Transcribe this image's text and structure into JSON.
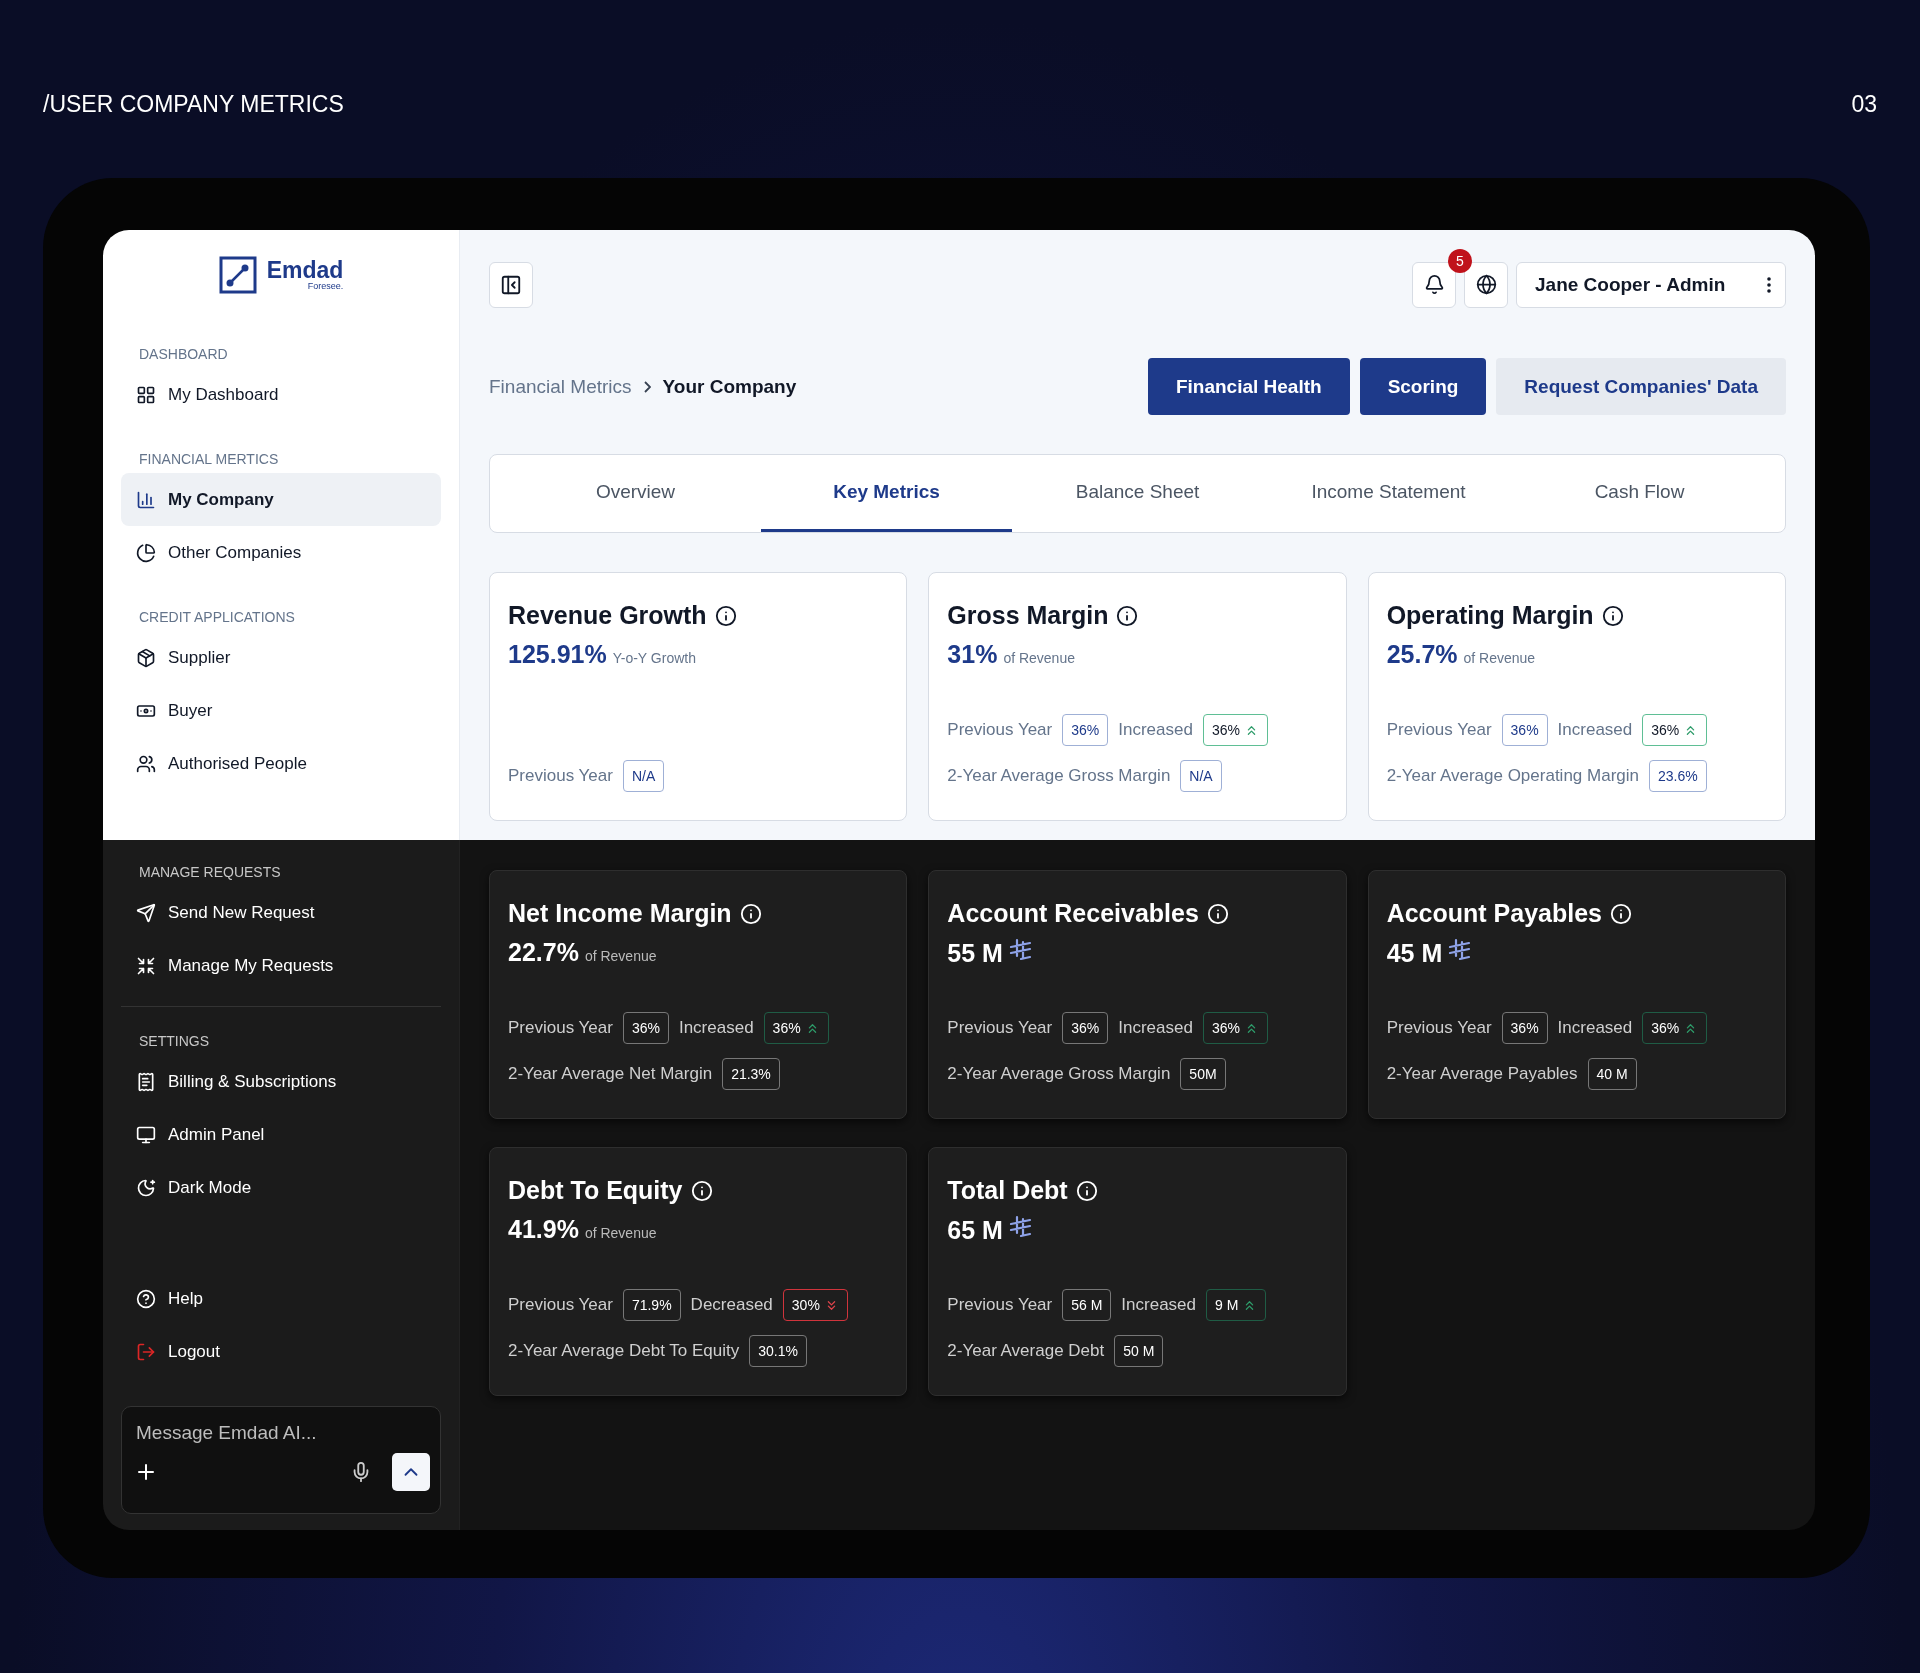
{
  "page_header": {
    "title": "/USER COMPANY METRICS",
    "number": "03"
  },
  "sidebar": {
    "logo": {
      "name": "Emdad",
      "tagline": "Foresee."
    },
    "sections": [
      {
        "heading": "DASHBOARD",
        "dark": false,
        "items": [
          {
            "label": "My Dashboard",
            "selected": false
          }
        ]
      },
      {
        "heading": "FINANCIAL MERTICS",
        "dark": false,
        "items": [
          {
            "label": "My Company",
            "selected": true
          },
          {
            "label": "Other Companies",
            "selected": false
          }
        ]
      },
      {
        "heading": "CREDIT APPLICATIONS",
        "dark": false,
        "items": [
          {
            "label": "Supplier",
            "selected": false
          },
          {
            "label": "Buyer",
            "selected": false
          },
          {
            "label": "Authorised People",
            "selected": false
          }
        ]
      },
      {
        "heading": "MANAGE REQUESTS",
        "dark": true,
        "divider": true,
        "items": [
          {
            "label": "Send New Request",
            "selected": false
          },
          {
            "label": "Manage My Requests",
            "selected": false
          }
        ]
      },
      {
        "heading": "SETTINGS",
        "dark": true,
        "items": [
          {
            "label": "Billing & Subscriptions",
            "selected": false
          },
          {
            "label": "Admin Panel",
            "selected": false
          },
          {
            "label": "Dark Mode",
            "selected": false
          }
        ]
      }
    ],
    "footer_items": [
      {
        "label": "Help",
        "kind": "normal"
      },
      {
        "label": "Logout",
        "kind": "danger"
      }
    ],
    "chat": {
      "placeholder": "Message Emdad AI..."
    }
  },
  "topbar": {
    "notifications": "5",
    "user": "Jane Cooper - Admin"
  },
  "breadcrumb": [
    {
      "label": "Financial Metrics",
      "selected": false
    },
    {
      "label": "Your Company",
      "selected": true
    }
  ],
  "actions": [
    {
      "label": "Financial Health",
      "kind": "primary"
    },
    {
      "label": "Scoring",
      "kind": "primary"
    },
    {
      "label": "Request Companies' Data",
      "kind": "secondary"
    }
  ],
  "tabs": [
    {
      "label": "Overview",
      "selected": false
    },
    {
      "label": "Key Metrics",
      "selected": true
    },
    {
      "label": "Balance Sheet",
      "selected": false
    },
    {
      "label": "Income Statement",
      "selected": false
    },
    {
      "label": "Cash Flow",
      "selected": false
    }
  ],
  "card_rows": [
    {
      "dark": false,
      "cards": [
        {
          "title": "Revenue Growth",
          "value": "125.91%",
          "note": "Y-o-Y Growth",
          "currency": false,
          "lines": [
            [
              {
                "label": "Previous Year",
                "value": "N/A",
                "kind": "plain"
              }
            ]
          ]
        },
        {
          "title": "Gross Margin",
          "value": "31%",
          "note": "of Revenue",
          "currency": false,
          "lines": [
            [
              {
                "label": "Previous Year",
                "value": "36%",
                "kind": "plain"
              },
              {
                "label": "Increased",
                "value": "36%",
                "kind": "up"
              }
            ],
            [
              {
                "label": "2-Year Average Gross Margin",
                "value": "N/A",
                "kind": "plain"
              }
            ]
          ]
        },
        {
          "title": "Operating Margin",
          "value": "25.7%",
          "note": "of Revenue",
          "currency": false,
          "lines": [
            [
              {
                "label": "Previous Year",
                "value": "36%",
                "kind": "plain"
              },
              {
                "label": "Increased",
                "value": "36%",
                "kind": "up"
              }
            ],
            [
              {
                "label": "2-Year Average Operating Margin",
                "value": "23.6%",
                "kind": "plain"
              }
            ]
          ]
        }
      ]
    },
    {
      "dark": true,
      "cards": [
        {
          "title": "Net Income Margin",
          "value": "22.7%",
          "note": "of Revenue",
          "currency": false,
          "lines": [
            [
              {
                "label": "Previous Year",
                "value": "36%",
                "kind": "plain"
              },
              {
                "label": "Increased",
                "value": "36%",
                "kind": "up"
              }
            ],
            [
              {
                "label": "2-Year Average Net Margin",
                "value": "21.3%",
                "kind": "plain"
              }
            ]
          ]
        },
        {
          "title": "Account Receivables",
          "value": "55 M",
          "currency": true,
          "lines": [
            [
              {
                "label": "Previous Year",
                "value": "36%",
                "kind": "plain"
              },
              {
                "label": "Increased",
                "value": "36%",
                "kind": "up"
              }
            ],
            [
              {
                "label": "2-Year Average Gross Margin",
                "value": "50M",
                "kind": "plain"
              }
            ]
          ]
        },
        {
          "title": "Account Payables",
          "value": "45 M",
          "currency": true,
          "lines": [
            [
              {
                "label": "Previous Year",
                "value": "36%",
                "kind": "plain"
              },
              {
                "label": "Increased",
                "value": "36%",
                "kind": "up"
              }
            ],
            [
              {
                "label": "2-Year Average Payables",
                "value": "40 M",
                "kind": "plain"
              }
            ]
          ]
        }
      ]
    },
    {
      "dark": true,
      "cards": [
        {
          "title": "Debt To Equity",
          "value": "41.9%",
          "note": "of Revenue",
          "currency": false,
          "lines": [
            [
              {
                "label": "Previous Year",
                "value": "71.9%",
                "kind": "plain"
              },
              {
                "label": "Decreased",
                "value": "30%",
                "kind": "down"
              }
            ],
            [
              {
                "label": "2-Year Average Debt To Equity",
                "value": "30.1%",
                "kind": "plain"
              }
            ]
          ]
        },
        {
          "title": "Total Debt",
          "value": "65 M",
          "currency": true,
          "lines": [
            [
              {
                "label": "Previous Year",
                "value": "56 M",
                "kind": "plain"
              },
              {
                "label": "Increased",
                "value": "9 M",
                "kind": "up"
              }
            ],
            [
              {
                "label": "2-Year Average Debt",
                "value": "50 M",
                "kind": "plain"
              }
            ]
          ]
        }
      ]
    }
  ]
}
